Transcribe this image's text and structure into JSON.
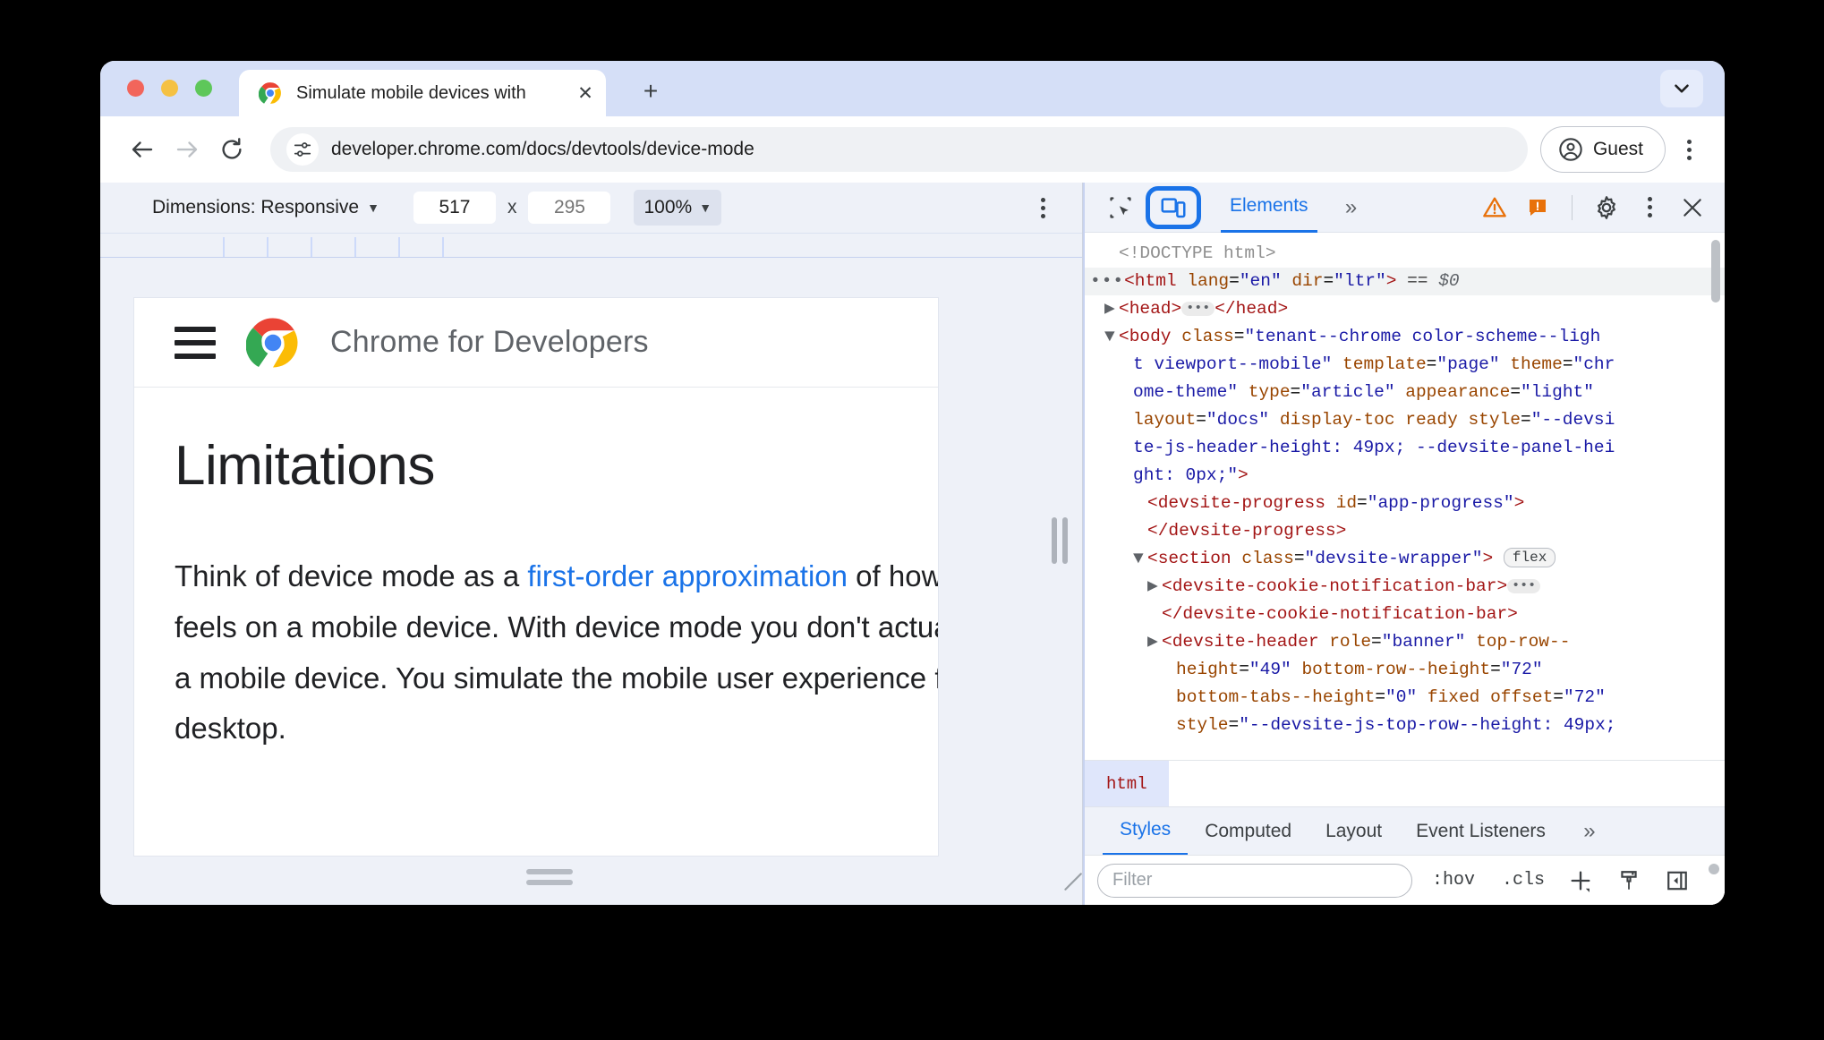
{
  "browser": {
    "tab": {
      "title": "Simulate mobile devices with",
      "favicon_icon": "chrome-logo-icon",
      "close_icon": "close-icon"
    },
    "new_tab_icon": "plus-icon",
    "tab_search_icon": "chevron-down-icon",
    "nav": {
      "back_icon": "arrow-left-icon",
      "forward_icon": "arrow-right-icon",
      "reload_icon": "reload-icon"
    },
    "omnibox": {
      "site_info_icon": "tune-settings-icon",
      "url": "developer.chrome.com/docs/devtools/device-mode"
    },
    "profile": {
      "label": "Guest",
      "icon": "account-circle-icon"
    },
    "menu_icon": "kebab-menu-icon"
  },
  "device_toolbar": {
    "dimensions_label": "Dimensions: Responsive",
    "dimensions_caret": "▼",
    "width": "517",
    "times": "x",
    "height": "295",
    "height_placeholder": "295",
    "zoom": "100%",
    "zoom_caret": "▼",
    "menu_icon": "kebab-menu-icon"
  },
  "viewport": {
    "site_header": {
      "menu_icon": "hamburger-menu-icon",
      "logo_icon": "chrome-logo-icon",
      "title": "Chrome for Developers"
    },
    "page": {
      "heading": "Limitations",
      "paragraph_part1": "Think of device mode as a ",
      "paragraph_link": "first-order approximation",
      "paragraph_part2": " of how your page looks and feels on a mobile device. With device mode you don't actually run your code on a mobile device. You simulate the mobile user experience from your laptop or desktop."
    },
    "resize_bottom_icon": "resize-handle-icon",
    "resize_right_icon": "resize-handle-icon",
    "resize_corner_icon": "resize-corner-icon"
  },
  "devtools": {
    "toolbar": {
      "inspect_icon": "inspect-element-icon",
      "device_toggle_icon": "device-toolbar-icon",
      "active_tab": "Elements",
      "overflow": "»",
      "warning_icon": "warning-triangle-icon",
      "error_icon": "error-badge-icon",
      "settings_icon": "gear-icon",
      "menu_icon": "kebab-menu-icon",
      "close_icon": "close-icon"
    },
    "dom_tree": [
      {
        "indent": 1,
        "marker": "",
        "html": "<span class=\"t-doctype\">&lt;!DOCTYPE html&gt;</span>",
        "selected": false
      },
      {
        "indent": 0,
        "marker": "dots",
        "html": "<span class=\"t-tag\">&lt;html</span> <span class=\"t-attr\">lang</span>=<span class=\"t-val\">\"en\"</span> <span class=\"t-attr\">dir</span>=<span class=\"t-val\">\"ltr\"</span><span class=\"t-tag\">&gt;</span> <span class=\"t-plain\">==</span> <span class=\"t-dollar\">$0</span>",
        "selected": true
      },
      {
        "indent": 1,
        "marker": "closed",
        "html": "<span class=\"t-tag\">&lt;head&gt;</span><span class=\"ellipsis-pill\">•••</span><span class=\"t-tag\">&lt;/head&gt;</span>",
        "selected": false
      },
      {
        "indent": 1,
        "marker": "open",
        "html": "<span class=\"t-tag\">&lt;body</span> <span class=\"t-attr\">class</span>=<span class=\"t-val\">\"tenant--chrome color-scheme--ligh</span>",
        "selected": false
      },
      {
        "indent": 2,
        "marker": "",
        "html": "<span class=\"t-val\">t viewport--mobile\"</span> <span class=\"t-attr\">template</span>=<span class=\"t-val\">\"page\"</span> <span class=\"t-attr\">theme</span>=<span class=\"t-val\">\"chr</span>",
        "selected": false
      },
      {
        "indent": 2,
        "marker": "",
        "html": "<span class=\"t-val\">ome-theme\"</span> <span class=\"t-attr\">type</span>=<span class=\"t-val\">\"article\"</span> <span class=\"t-attr\">appearance</span>=<span class=\"t-val\">\"light\"</span>",
        "selected": false
      },
      {
        "indent": 2,
        "marker": "",
        "html": "<span class=\"t-attr\">layout</span>=<span class=\"t-val\">\"docs\"</span> <span class=\"t-attr\">display-toc ready</span> <span class=\"t-attr\">style</span>=<span class=\"t-val\">\"--devsi</span>",
        "selected": false
      },
      {
        "indent": 2,
        "marker": "",
        "html": "<span class=\"t-val\">te-js-header-height: 49px; --devsite-panel-hei</span>",
        "selected": false
      },
      {
        "indent": 2,
        "marker": "",
        "html": "<span class=\"t-val\">ght: 0px;\"</span><span class=\"t-tag\">&gt;</span>",
        "selected": false
      },
      {
        "indent": 3,
        "marker": "",
        "html": "<span class=\"t-tag\">&lt;devsite-progress</span> <span class=\"t-attr\">id</span>=<span class=\"t-val\">\"app-progress\"</span><span class=\"t-tag\">&gt;</span>",
        "selected": false
      },
      {
        "indent": 3,
        "marker": "",
        "html": "<span class=\"t-tag\">&lt;/devsite-progress&gt;</span>",
        "selected": false
      },
      {
        "indent": 3,
        "marker": "open",
        "html": "<span class=\"t-tag\">&lt;section</span> <span class=\"t-attr\">class</span>=<span class=\"t-val\">\"devsite-wrapper\"</span><span class=\"t-tag\">&gt;</span> <span class=\"flex-badge\">flex</span>",
        "selected": false
      },
      {
        "indent": 4,
        "marker": "closed",
        "html": "<span class=\"t-tag\">&lt;devsite-cookie-notification-bar&gt;</span><span class=\"ellipsis-pill\">•••</span>",
        "selected": false
      },
      {
        "indent": 4,
        "marker": "",
        "html": "<span class=\"t-tag\">&lt;/devsite-cookie-notification-bar&gt;</span>",
        "selected": false
      },
      {
        "indent": 4,
        "marker": "closed",
        "html": "<span class=\"t-tag\">&lt;devsite-header</span> <span class=\"t-attr\">role</span>=<span class=\"t-val\">\"banner\"</span> <span class=\"t-attr\">top-row--</span>",
        "selected": false
      },
      {
        "indent": 5,
        "marker": "",
        "html": "<span class=\"t-attr\">height</span>=<span class=\"t-val\">\"49\"</span> <span class=\"t-attr\">bottom-row--height</span>=<span class=\"t-val\">\"72\"</span>",
        "selected": false
      },
      {
        "indent": 5,
        "marker": "",
        "html": "<span class=\"t-attr\">bottom-tabs--height</span>=<span class=\"t-val\">\"0\"</span> <span class=\"t-attr\">fixed offset</span>=<span class=\"t-val\">\"72\"</span>",
        "selected": false
      },
      {
        "indent": 5,
        "marker": "",
        "html": "<span class=\"t-attr\">style</span>=<span class=\"t-val\">\"--devsite-js-top-row--height: 49px;</span>",
        "selected": false
      }
    ],
    "breadcrumb": [
      "html"
    ],
    "styles_tabs": [
      "Styles",
      "Computed",
      "Layout",
      "Event Listeners"
    ],
    "styles_overflow": "»",
    "styles_toolbar": {
      "filter_placeholder": "Filter",
      "hov_label": ":hov",
      "cls_label": ".cls",
      "new_rule_icon": "plus-new-style-rule-icon",
      "computed_styles_icon": "paintbrush-icon",
      "sidebar_toggle_icon": "toggle-sidebar-icon"
    }
  },
  "colors": {
    "accent_blue": "#1a73e8",
    "tab_strip_bg": "#d5dff7",
    "devtools_toolbar_bg": "#eff2f9",
    "warning_orange": "#e8710a"
  }
}
